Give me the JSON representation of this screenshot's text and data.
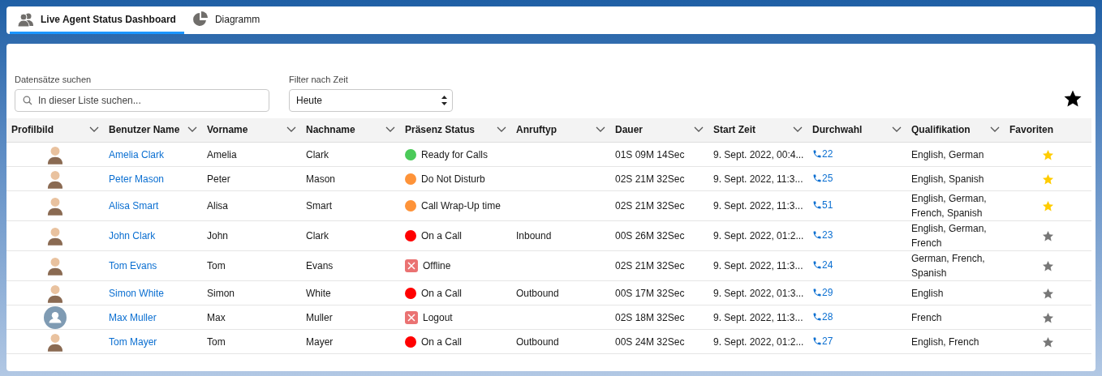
{
  "tabs": [
    {
      "label": "Live Agent Status Dashboard",
      "selected": true
    },
    {
      "label": "Diagramm",
      "selected": false
    }
  ],
  "search": {
    "label": "Datensätze suchen",
    "placeholder": "In dieser Liste suchen..."
  },
  "time_filter": {
    "label": "Filter nach Zeit",
    "value": "Heute"
  },
  "favorites_toggle": {
    "on": true
  },
  "table": {
    "columns": [
      {
        "label": "Profilbild",
        "menu": true
      },
      {
        "label": "Benutzer Name",
        "menu": true
      },
      {
        "label": "Vorname",
        "menu": true
      },
      {
        "label": "Nachname",
        "menu": true
      },
      {
        "label": "Präsenz Status",
        "menu": true
      },
      {
        "label": "Anruftyp",
        "menu": true
      },
      {
        "label": "Dauer",
        "menu": true
      },
      {
        "label": "Start Zeit",
        "menu": true
      },
      {
        "label": "Durchwahl",
        "menu": true
      },
      {
        "label": "Qualifikation",
        "menu": true
      },
      {
        "label": "Favoriten",
        "menu": false
      }
    ],
    "rows": [
      {
        "has_photo": true,
        "user_name": "Amelia Clark",
        "first_name": "Amelia",
        "last_name": "Clark",
        "status": {
          "kind": "dot",
          "color": "#4bca59",
          "label": "Ready for Calls"
        },
        "duration": "01S 09M 14Sec",
        "start": "9. Sept. 2022, 00:4...",
        "extension": "22",
        "qualification": "English, German",
        "favorite": true
      },
      {
        "has_photo": true,
        "user_name": "Peter Mason",
        "first_name": "Peter",
        "last_name": "Mason",
        "status": {
          "kind": "dot",
          "color": "#fe9339",
          "label": "Do Not Disturb"
        },
        "duration": "02S 21M 32Sec",
        "start": "9. Sept. 2022, 11:3...",
        "extension": "25",
        "qualification": "English, Spanish",
        "favorite": true
      },
      {
        "has_photo": true,
        "user_name": "Alisa Smart",
        "first_name": "Alisa",
        "last_name": "Smart",
        "status": {
          "kind": "dot",
          "color": "#fe9339",
          "label": "Call Wrap-Up time"
        },
        "duration": "02S 21M 32Sec",
        "start": "9. Sept. 2022, 11:3...",
        "extension": "51",
        "qualification": "English, German, French, Spanish",
        "favorite": true
      },
      {
        "has_photo": true,
        "user_name": "John Clark",
        "first_name": "John",
        "last_name": "Clark",
        "status": {
          "kind": "dot",
          "color": "#ff0000",
          "label": "On a Call"
        },
        "call_type": "Inbound",
        "duration": "00S 26M 32Sec",
        "start": "9. Sept. 2022, 01:2...",
        "extension": "23",
        "qualification": "English, German, French",
        "favorite": false
      },
      {
        "has_photo": true,
        "user_name": "Tom Evans",
        "first_name": "Tom",
        "last_name": "Evans",
        "status": {
          "kind": "cross",
          "color": "#ea7272",
          "label": "Offline"
        },
        "duration": "02S 21M 32Sec",
        "start": "9. Sept. 2022, 11:3...",
        "extension": "24",
        "qualification": "German, French, Spanish",
        "favorite": false
      },
      {
        "has_photo": true,
        "user_name": "Simon White",
        "first_name": "Simon",
        "last_name": "White",
        "status": {
          "kind": "dot",
          "color": "#ff0000",
          "label": "On a Call"
        },
        "call_type": "Outbound",
        "duration": "00S 17M 32Sec",
        "start": "9. Sept. 2022, 01:3...",
        "extension": "29",
        "qualification": "English",
        "favorite": false
      },
      {
        "has_photo": false,
        "user_name": "Max Muller",
        "first_name": "Max",
        "last_name": "Muller",
        "status": {
          "kind": "cross",
          "color": "#ea7272",
          "label": "Logout"
        },
        "duration": "02S 18M 32Sec",
        "start": "9. Sept. 2022, 11:3...",
        "extension": "28",
        "qualification": "French",
        "favorite": false
      },
      {
        "has_photo": true,
        "user_name": "Tom Mayer",
        "first_name": "Tom",
        "last_name": "Mayer",
        "status": {
          "kind": "dot",
          "color": "#ff0000",
          "label": "On a Call"
        },
        "call_type": "Outbound",
        "duration": "00S 24M 32Sec",
        "start": "9. Sept. 2022, 01:2...",
        "extension": "27",
        "qualification": "English, French",
        "favorite": false
      }
    ]
  }
}
